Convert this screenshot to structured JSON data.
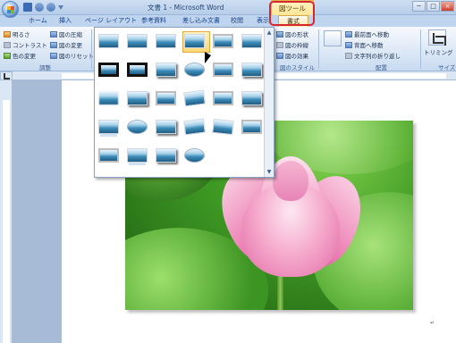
{
  "window": {
    "title": "文書 1 - Microsoft Word",
    "context_tool_label": "図ツール",
    "controls": [
      "─",
      "□",
      "×"
    ]
  },
  "tabs": [
    "ホーム",
    "挿入",
    "ページ レイアウト",
    "参考資料",
    "差し込み文書",
    "校閲",
    "表示"
  ],
  "active_tab": "書式",
  "ribbon": {
    "adjust_group": {
      "label": "調整",
      "brightness": "明るさ",
      "contrast": "コントラスト",
      "recolor": "色の変更",
      "compress": "図の圧縮",
      "change_picture": "図の変更",
      "reset_picture": "図のリセット"
    },
    "picture_styles_group": {
      "label": "図のスタイル",
      "shape": "図の形状",
      "border": "図の枠線",
      "effects": "図の効果"
    },
    "arrange_group": {
      "label": "配置",
      "bring_front": "最前面へ移動",
      "send_back": "背面へ移動",
      "text_wrap": "文字列の折り返し"
    },
    "size_group": {
      "label": "サイズ",
      "crop": "トリミング"
    }
  },
  "gallery": {
    "selected_index": 3,
    "item_count": 28,
    "scroll_up": "▲",
    "scroll_down": "▼"
  },
  "document": {
    "image": "lotus-flower-photo",
    "end_mark": "↵"
  },
  "colors": {
    "ribbon_blue": "#dbe7f5",
    "highlight_red": "#d8262e",
    "context_tab_yellow": "#f9dc74",
    "gallery_selected": "#ffd776"
  }
}
